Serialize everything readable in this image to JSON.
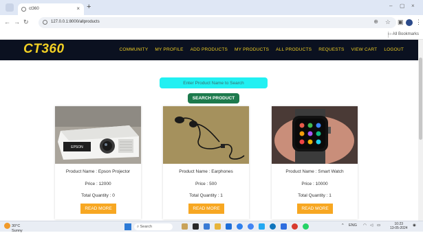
{
  "browser": {
    "tab_title": "ct360",
    "tab_close": "×",
    "new_tab": "+",
    "url": "127.0.0.1:8000/allproducts",
    "all_bookmarks": "All Bookmarks",
    "window_controls": [
      "–",
      "▢",
      "×"
    ]
  },
  "app": {
    "brand": "CT360",
    "menu": [
      "COMMUNITY",
      "MY PROFILE",
      "ADD PRODUCTS",
      "MY PRODUCTS",
      "ALL PRODUCTS",
      "REQUESTS",
      "VIEW CART",
      "LOGOUT"
    ],
    "accent_color": "#f2d024",
    "navbar_color": "#0b1120"
  },
  "search": {
    "placeholder": "Enter Product Name to Search",
    "button_label": "SEARCH PRODUCT"
  },
  "products": [
    {
      "name": "Product Name : Epson Projector",
      "price": "Price : 12000",
      "quantity": "Total Quantity : 0",
      "button": "READ MORE",
      "brand_mark": "EPSON"
    },
    {
      "name": "Product Name : Earphones",
      "price": "Price : 500",
      "quantity": "Total Quantity : 1",
      "button": "READ MORE"
    },
    {
      "name": "Product Name : Smart Watch",
      "price": "Price : 10000",
      "quantity": "Total Quantity : 1",
      "button": "READ MORE"
    }
  ],
  "taskbar": {
    "weather_temp": "30°C",
    "weather_desc": "Sunny",
    "search_label": "Search",
    "lang": "ENG",
    "time": "10:23",
    "date": "13-05-2024"
  }
}
